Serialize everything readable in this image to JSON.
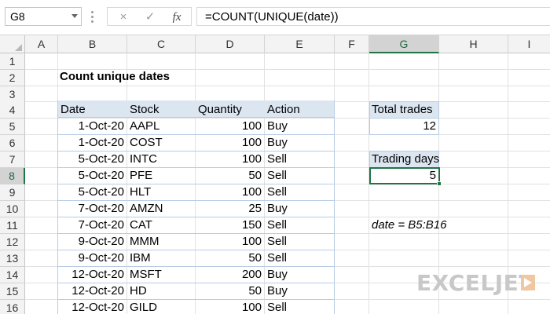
{
  "formula_bar": {
    "name_box": "G8",
    "cancel_icon": "×",
    "enter_icon": "✓",
    "fx_label": "fx",
    "formula": "=COUNT(UNIQUE(date))"
  },
  "columns": [
    "A",
    "B",
    "C",
    "D",
    "E",
    "F",
    "G",
    "H",
    "I"
  ],
  "selected_column": "G",
  "rows": [
    "1",
    "2",
    "3",
    "4",
    "5",
    "6",
    "7",
    "8",
    "9",
    "10",
    "11",
    "12",
    "13",
    "14",
    "15",
    "16"
  ],
  "selected_row": "8",
  "sheet": {
    "title": "Count unique dates",
    "table_headers": {
      "date": "Date",
      "stock": "Stock",
      "quantity": "Quantity",
      "action": "Action"
    },
    "table_rows": [
      {
        "date": "1-Oct-20",
        "stock": "AAPL",
        "quantity": "100",
        "action": "Buy"
      },
      {
        "date": "1-Oct-20",
        "stock": "COST",
        "quantity": "100",
        "action": "Buy"
      },
      {
        "date": "5-Oct-20",
        "stock": "INTC",
        "quantity": "100",
        "action": "Sell"
      },
      {
        "date": "5-Oct-20",
        "stock": "PFE",
        "quantity": "50",
        "action": "Sell"
      },
      {
        "date": "5-Oct-20",
        "stock": "HLT",
        "quantity": "100",
        "action": "Sell"
      },
      {
        "date": "7-Oct-20",
        "stock": "AMZN",
        "quantity": "25",
        "action": "Buy"
      },
      {
        "date": "7-Oct-20",
        "stock": "CAT",
        "quantity": "150",
        "action": "Sell"
      },
      {
        "date": "9-Oct-20",
        "stock": "MMM",
        "quantity": "100",
        "action": "Sell"
      },
      {
        "date": "9-Oct-20",
        "stock": "IBM",
        "quantity": "50",
        "action": "Sell"
      },
      {
        "date": "12-Oct-20",
        "stock": "MSFT",
        "quantity": "200",
        "action": "Buy"
      },
      {
        "date": "12-Oct-20",
        "stock": "HD",
        "quantity": "50",
        "action": "Buy"
      },
      {
        "date": "12-Oct-20",
        "stock": "GILD",
        "quantity": "100",
        "action": "Sell"
      }
    ],
    "total_trades_label": "Total trades",
    "total_trades_value": "12",
    "trading_days_label": "Trading days",
    "trading_days_value": "5",
    "named_range_note": "date = B5:B16"
  },
  "logo": {
    "text": "EXCELJET"
  },
  "colors": {
    "accent": "#217346",
    "table_header": "#dce6f1",
    "table_border": "#b8cce4"
  }
}
